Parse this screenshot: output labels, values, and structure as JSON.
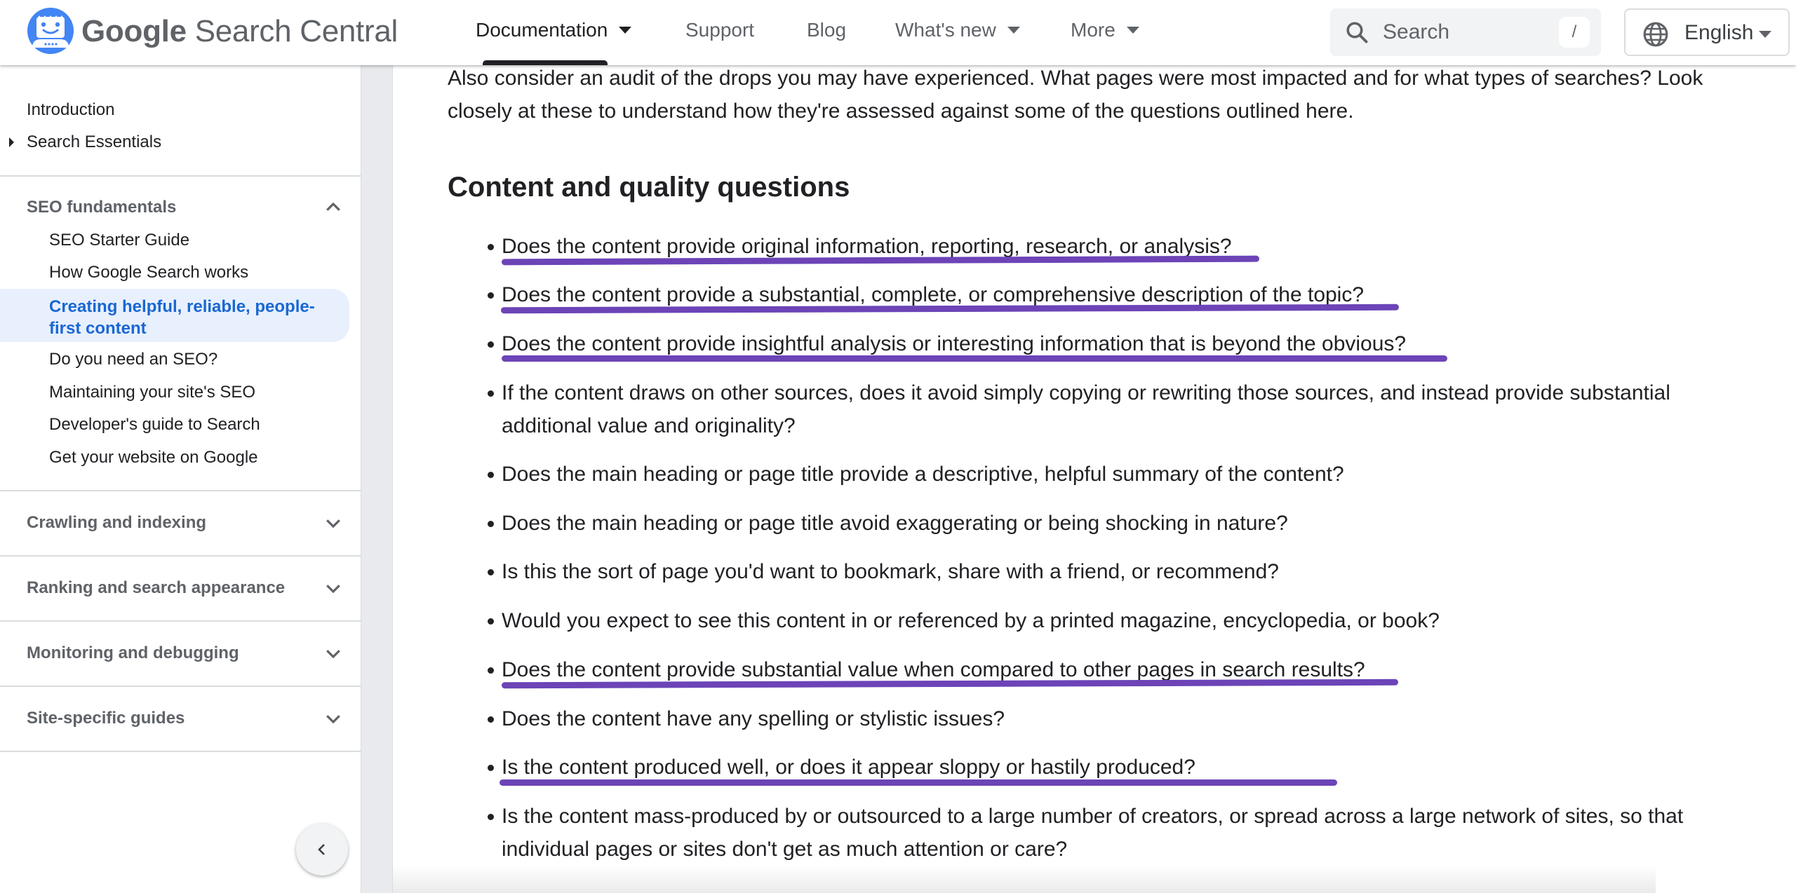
{
  "header": {
    "brand_bold": "Google",
    "brand_rest": " Search Central",
    "nav": [
      {
        "label": "Documentation",
        "has_caret": true,
        "active": true
      },
      {
        "label": "Support",
        "has_caret": false
      },
      {
        "label": "Blog",
        "has_caret": false
      },
      {
        "label": "What's new",
        "has_caret": true
      },
      {
        "label": "More",
        "has_caret": true
      }
    ],
    "search": {
      "placeholder": "Search",
      "shortcut": "/"
    },
    "language": "English"
  },
  "sidebar": {
    "top_items": [
      {
        "label": "Introduction"
      },
      {
        "label": "Search Essentials",
        "expandable": true
      }
    ],
    "sections": [
      {
        "label": "SEO fundamentals",
        "expanded": true,
        "items": [
          "SEO Starter Guide",
          "How Google Search works",
          "Creating helpful, reliable, people-first content",
          "Do you need an SEO?",
          "Maintaining your site's SEO",
          "Developer's guide to Search",
          "Get your website on Google"
        ],
        "active_index": 2
      },
      {
        "label": "Crawling and indexing",
        "expanded": false
      },
      {
        "label": "Ranking and search appearance",
        "expanded": false
      },
      {
        "label": "Monitoring and debugging",
        "expanded": false
      },
      {
        "label": "Site-specific guides",
        "expanded": false
      }
    ]
  },
  "main": {
    "intro": "Also consider an audit of the drops you may have experienced. What pages were most impacted and for what types of searches? Look closely at these to understand how they're assessed against some of the questions outlined here.",
    "heading": "Content and quality questions",
    "highlight_color": "#6c44b7",
    "questions": [
      {
        "text": "Does the content provide original information, reporting, research, or analysis?",
        "highlighted": true
      },
      {
        "text": "Does the content provide a substantial, complete, or comprehensive description of the topic?",
        "highlighted": true
      },
      {
        "text": "Does the content provide insightful analysis or interesting information that is beyond the obvious?",
        "highlighted": true
      },
      {
        "text": "If the content draws on other sources, does it avoid simply copying or rewriting those sources, and instead provide substantial additional value and originality?",
        "highlighted": false
      },
      {
        "text": "Does the main heading or page title provide a descriptive, helpful summary of the content?",
        "highlighted": false
      },
      {
        "text": "Does the main heading or page title avoid exaggerating or being shocking in nature?",
        "highlighted": false
      },
      {
        "text": "Is this the sort of page you'd want to bookmark, share with a friend, or recommend?",
        "highlighted": false
      },
      {
        "text": "Would you expect to see this content in or referenced by a printed magazine, encyclopedia, or book?",
        "highlighted": false
      },
      {
        "text": "Does the content provide substantial value when compared to other pages in search results?",
        "highlighted": true
      },
      {
        "text": "Does the content have any spelling or stylistic issues?",
        "highlighted": false
      },
      {
        "text": "Is the content produced well, or does it appear sloppy or hastily produced?",
        "highlighted": true
      },
      {
        "text": "Is the content mass-produced by or outsourced to a large number of creators, or spread across a large network of sites, so that individual pages or sites don't get as much attention or care?",
        "highlighted": false
      }
    ]
  }
}
